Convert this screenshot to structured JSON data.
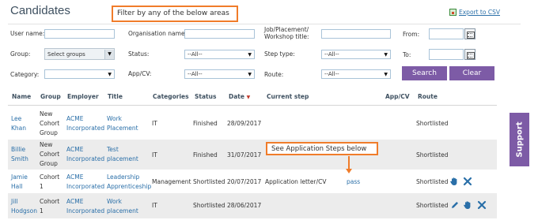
{
  "header": {
    "title": "Candidates",
    "callout": "Filter by any of the below areas",
    "export_label": "Export to CSV"
  },
  "filters": {
    "user_name_label": "User name:",
    "org_name_label": "Organisation name:",
    "job_title_label_1": "Job/Placement/",
    "job_title_label_2": "Workshop title:",
    "from_label": "From:",
    "group_label": "Group:",
    "group_value": "Select groups",
    "status_label": "Status:",
    "status_value": "--All--",
    "step_type_label": "Step type:",
    "step_type_value": "--All--",
    "to_label": "To:",
    "category_label": "Category:",
    "category_value": "",
    "app_cv_label": "App/CV:",
    "app_cv_value": "--All--",
    "route_label": "Route:",
    "route_value": "--All--",
    "search_label": "Search",
    "clear_label": "Clear"
  },
  "table": {
    "headers": {
      "name": "Name",
      "group": "Group",
      "employer": "Employer",
      "title": "Title",
      "categories": "Categories",
      "status": "Status",
      "date": "Date",
      "current_step": "Current step",
      "app_cv": "App/CV",
      "route": "Route"
    },
    "rows": [
      {
        "name_1": "Lee",
        "name_2": "Khan",
        "group_1": "New",
        "group_2": "Cohort",
        "group_3": "Group",
        "employer_1": "ACME",
        "employer_2": "Incorporated",
        "title_1": "Work",
        "title_2": "Placement",
        "category": "IT",
        "status": "Finished",
        "date": "28/09/2017",
        "current_step": "",
        "app_cv": "",
        "route": "Shortlisted"
      },
      {
        "name_1": "Billie",
        "name_2": "Smith",
        "group_1": "New",
        "group_2": "Cohort",
        "group_3": "Group",
        "employer_1": "ACME",
        "employer_2": "Incorporated",
        "title_1": "Test",
        "title_2": "placement",
        "category": "IT",
        "status": "Finished",
        "date": "31/07/2017",
        "current_step": "",
        "app_cv": "",
        "route": "Shortlisted"
      },
      {
        "name_1": "Jamie",
        "name_2": "Hall",
        "group_1": "Cohort",
        "group_2": "1",
        "employer_1": "ACME",
        "employer_2": "Incorporated",
        "title_1": "Leadership",
        "title_2": "Apprenticeship",
        "category": "Management",
        "status": "Shortlisted",
        "date": "20/07/2017",
        "current_step": "Application letter/CV",
        "app_cv": "pass",
        "route": "Shortlisted"
      },
      {
        "name_1": "Jill",
        "name_2": "Hodgson",
        "group_1": "Cohort",
        "group_2": "1",
        "employer_1": "ACME",
        "employer_2": "Incorporated",
        "title_1": "Work",
        "title_2": "placement",
        "category": "IT",
        "status": "Shortlisted",
        "date": "28/06/2017",
        "current_step": "",
        "app_cv": "",
        "route": "Shortlisted"
      }
    ],
    "steps_callout": "See Application Steps below"
  },
  "support_label": "Support",
  "colors": {
    "accent": "#7d5ba6",
    "callout_border": "#f07c2a",
    "link": "#2a6fa8"
  }
}
